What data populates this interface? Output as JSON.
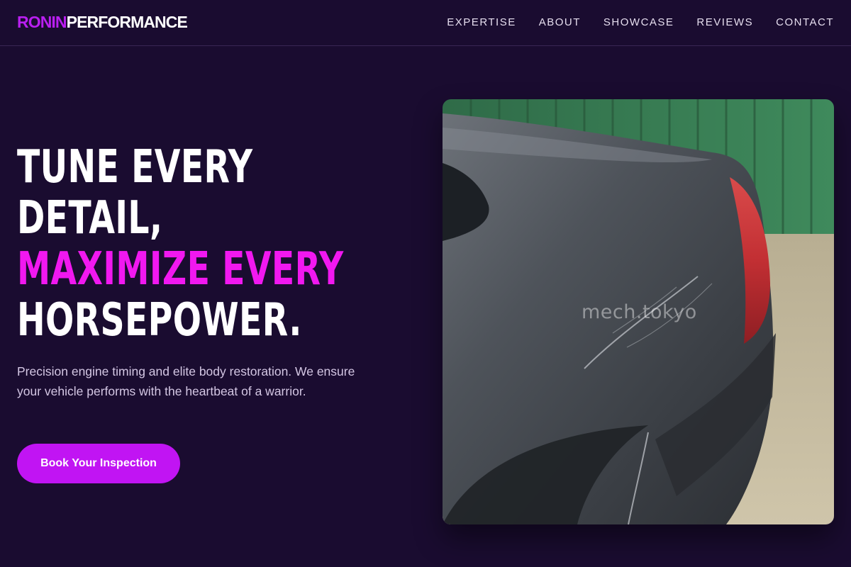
{
  "brand": {
    "accent": "RONIN",
    "main": "PERFORMANCE",
    "accent_color": "#b91ff0"
  },
  "nav": {
    "items": [
      {
        "label": "EXPERTISE"
      },
      {
        "label": "ABOUT"
      },
      {
        "label": "SHOWCASE"
      },
      {
        "label": "REVIEWS"
      },
      {
        "label": "CONTACT"
      }
    ]
  },
  "hero": {
    "headline": {
      "line1": "TUNE EVERY",
      "line2": "DETAIL,",
      "line3": "MAXIMIZE EVERY",
      "line4": "HORSEPOWER.",
      "accent_color": "#f118f0"
    },
    "subtitle": "Precision engine timing and elite body restoration. We ensure your vehicle performs with the heartbeat of a warrior.",
    "cta_label": "Book Your Inspection",
    "image": {
      "subject": "close-up of a damaged grey car rear quarter panel",
      "watermark": "mech.tokyo"
    }
  },
  "colors": {
    "background": "#1a0c30",
    "button": "#c114f3"
  }
}
